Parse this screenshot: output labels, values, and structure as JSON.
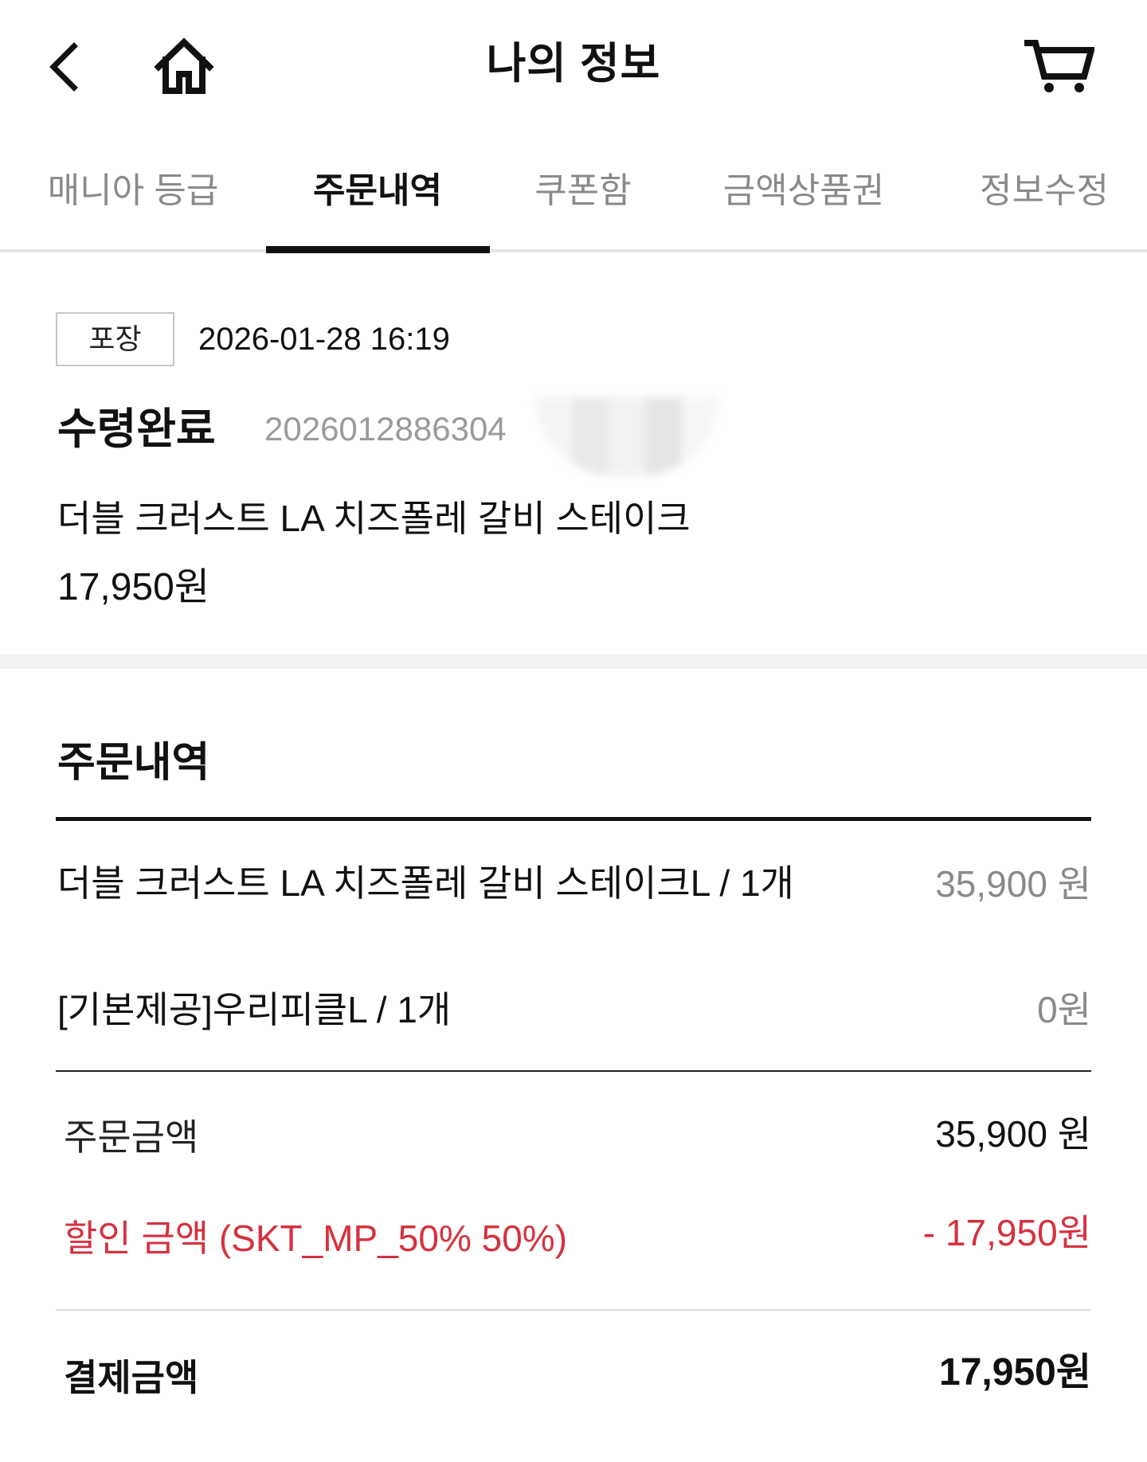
{
  "header": {
    "title": "나의 정보",
    "icons": {
      "back": "chevron-left-icon",
      "home": "home-icon",
      "cart": "cart-icon"
    }
  },
  "tabs": {
    "active_tab_index": 1,
    "items": [
      {
        "label": "매니아 등급"
      },
      {
        "label": "주문내역"
      },
      {
        "label": "쿠폰함"
      },
      {
        "label": "금액상품권"
      },
      {
        "label": "정보수정"
      }
    ]
  },
  "order": {
    "type_badge": "포장",
    "datetime": "2026-01-28 16:19",
    "status": "수령완료",
    "order_number": "2026012886304",
    "product_name": "더블 크러스트 LA 치즈폴레 갈비 스테이크",
    "price": "17,950원"
  },
  "order_detail": {
    "heading": "주문내역",
    "items": [
      {
        "name": "더블 크러스트 LA 치즈폴레 갈비 스테이크L / 1개",
        "price": "35,900 원"
      },
      {
        "name": "[기본제공]우리피클L / 1개",
        "price": "0원"
      }
    ],
    "summary": {
      "order_amount_label": "주문금액",
      "order_amount": "35,900 원",
      "discount_label": "할인 금액 (SKT_MP_50% 50%)",
      "discount_amount": "- 17,950원",
      "payment_label": "결제금액",
      "payment_amount": "17,950원"
    }
  },
  "colors": {
    "text": "#111111",
    "muted": "#8a8a8a",
    "discount_red": "#d6313e",
    "divider": "#e3e3e3"
  }
}
